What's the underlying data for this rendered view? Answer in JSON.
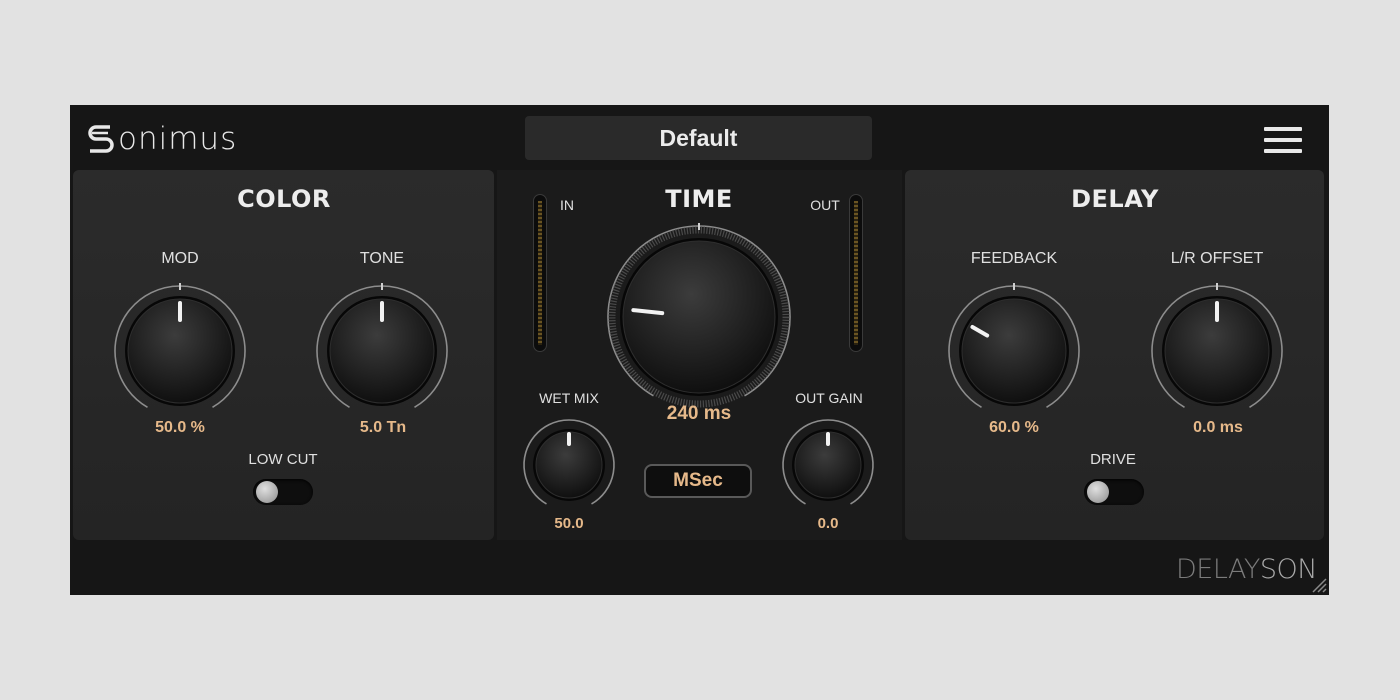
{
  "brand": {
    "name": "onimus",
    "logo_glyph": "S"
  },
  "preset": {
    "name": "Default"
  },
  "menu": {
    "icon": "hamburger-menu-icon"
  },
  "color_section": {
    "title": "COLOR",
    "mod": {
      "label": "MOD",
      "value": "50.0 %",
      "level": 0.5
    },
    "tone": {
      "label": "TONE",
      "value": "5.0 Tn",
      "level": 0.5
    },
    "low_cut": {
      "label": "LOW CUT",
      "on": false
    }
  },
  "time_section": {
    "title": "TIME",
    "in_label": "IN",
    "out_label": "OUT",
    "time": {
      "value": "240 ms",
      "level": 0.22
    },
    "wet_mix": {
      "label": "WET MIX",
      "value": "50.0",
      "level": 0.5
    },
    "out_gain": {
      "label": "OUT GAIN",
      "value": "0.0",
      "level": 0.5
    },
    "mode_button": "MSec"
  },
  "delay_section": {
    "title": "DELAY",
    "feedback": {
      "label": "FEEDBACK",
      "value": "60.0 %",
      "level": 0.3
    },
    "lr_offset": {
      "label": "L/R OFFSET",
      "value": "0.0 ms",
      "level": 0.5
    },
    "drive": {
      "label": "DRIVE",
      "on": false
    }
  },
  "product": {
    "part1": "DELAY",
    "part2": "SON"
  },
  "colors": {
    "value_text": "#e6b98a",
    "panel": "#282828",
    "background": "#161616"
  }
}
